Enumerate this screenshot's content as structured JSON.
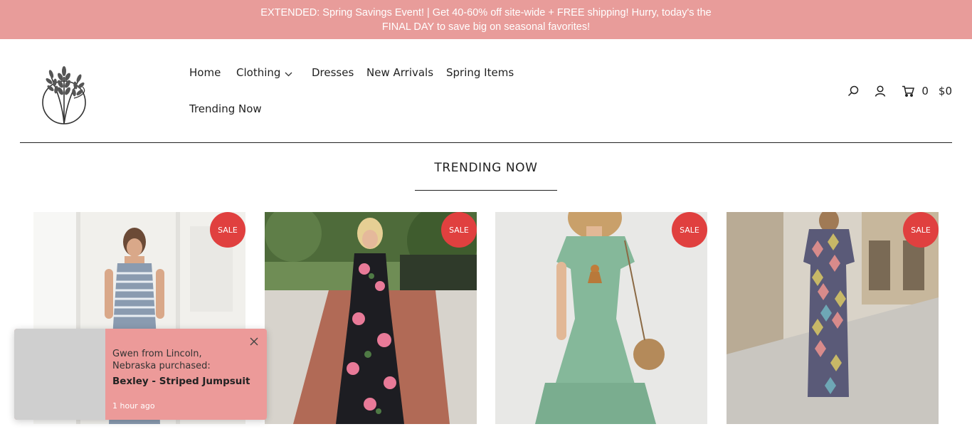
{
  "announcement": {
    "text": "EXTENDED: Spring Savings Event! | Get 40-60% off site-wide + FREE shipping! Hurry, today's the FINAL DAY to save big on seasonal favorites!"
  },
  "header": {
    "logo_icon": "wheat-logo-icon",
    "nav": [
      {
        "label": "Home"
      },
      {
        "label": "Clothing",
        "has_dropdown": true
      },
      {
        "label": "Dresses"
      },
      {
        "label": "New Arrivals"
      },
      {
        "label": "Spring Items"
      },
      {
        "label": "Trending Now"
      }
    ],
    "utilities": {
      "search_icon": "search-icon",
      "account_icon": "user-icon",
      "cart_icon": "cart-icon",
      "cart_count": "0",
      "cart_total": "$0"
    }
  },
  "section": {
    "title": "TRENDING NOW"
  },
  "products": [
    {
      "badge": "SALE"
    },
    {
      "badge": "SALE"
    },
    {
      "badge": "SALE"
    },
    {
      "badge": "SALE"
    }
  ],
  "colors": {
    "announcement_bg": "#e89c9a",
    "sale_badge": "#e0403f",
    "toast_bg": "#ec9a99"
  },
  "notification": {
    "message": "Gwen from Lincoln, Nebraska purchased:",
    "product": "Bexley - Striped Jumpsuit",
    "time": "1 hour ago",
    "close_icon": "close-icon"
  }
}
